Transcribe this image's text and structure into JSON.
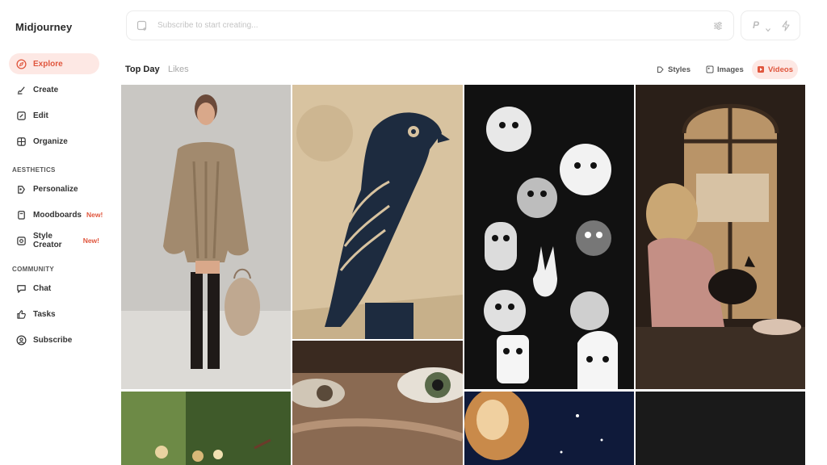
{
  "app": {
    "title": "Midjourney"
  },
  "sidebar": {
    "items": [
      {
        "label": "Explore",
        "icon": "compass-icon",
        "active": true
      },
      {
        "label": "Create",
        "icon": "brush-icon"
      },
      {
        "label": "Edit",
        "icon": "edit-icon"
      },
      {
        "label": "Organize",
        "icon": "grid-icon"
      }
    ],
    "aesthetics_label": "AESTHETICS",
    "aesthetics": [
      {
        "label": "Personalize",
        "icon": "personalize-icon"
      },
      {
        "label": "Moodboards",
        "icon": "moodboard-icon",
        "badge": "New!"
      },
      {
        "label": "Style Creator",
        "icon": "style-creator-icon",
        "badge": "New!"
      }
    ],
    "community_label": "COMMUNITY",
    "community": [
      {
        "label": "Chat",
        "icon": "chat-icon"
      },
      {
        "label": "Tasks",
        "icon": "thumbs-up-icon"
      },
      {
        "label": "Subscribe",
        "icon": "user-circle-icon"
      }
    ]
  },
  "prompt": {
    "placeholder": "Subscribe to start creating..."
  },
  "mode": {
    "label": "P"
  },
  "tabs": {
    "top_day": "Top Day",
    "likes": "Likes"
  },
  "filters": {
    "styles": "Styles",
    "images": "Images",
    "videos": "Videos"
  },
  "colors": {
    "accent": "#e0563d",
    "accent_bg": "#fde8e4"
  }
}
